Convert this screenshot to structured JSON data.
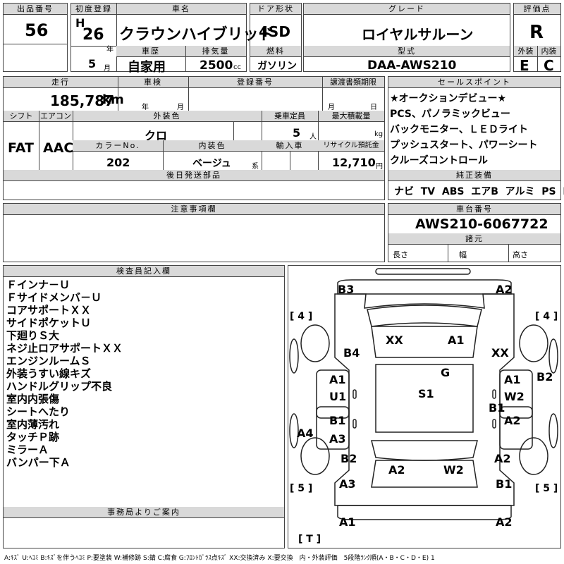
{
  "header": {
    "lot_label": "出品番号",
    "lot_no": "56",
    "reg_label": "初度登録",
    "era": "H",
    "reg_year": "26",
    "year_unit": "年",
    "reg_month": "5",
    "month_unit": "月",
    "name_label": "車名",
    "car_name": "クラウンハイブリッド",
    "history_label": "車歴",
    "history": "自家用",
    "disp_label": "排気量",
    "displacement": "2500",
    "cc": "cc",
    "door_label": "ドア形状",
    "door": "4SD",
    "fuel_label": "燃料",
    "fuel": "ガソリン",
    "grade_label": "グレード",
    "grade": "ロイヤルサルーン",
    "model_label": "型式",
    "model": "DAA-AWS210",
    "score_label": "評価点",
    "score": "R",
    "ext_label": "外装",
    "ext_grade": "E",
    "int_label": "内装",
    "int_grade": "C"
  },
  "row2": {
    "mileage_label": "走行",
    "mileage": "185,787",
    "km": "km",
    "inspection_label": "車検",
    "year_unit": "年",
    "month_unit": "月",
    "regno_label": "登録番号",
    "transfer_label": "譲渡書類期限",
    "transfer_month": "月",
    "transfer_day": "日",
    "shift_label": "シフト",
    "shift": "FAT",
    "ac_label": "エアコン",
    "ac": "AAC",
    "color_label": "外装色",
    "color": "クロ",
    "capacity_label": "乗車定員",
    "capacity": "5",
    "person": "人",
    "maxload_label": "最大積載量",
    "kg": "kg",
    "colorno_label": "カラーNo.",
    "colorno": "202",
    "interior_label": "内装色",
    "interior": "ベージュ",
    "kei": "系",
    "import_label": "輸入車",
    "recycle_label": "リサイクル預託金",
    "recycle": "12,710",
    "yen": "円",
    "later_parts_label": "後日発送部品"
  },
  "selling": {
    "label": "セールスポイント",
    "lines": [
      "★オークションデビュー★",
      "PCS、パノラミックビュー",
      "バックモニター、ＬＥＤライト",
      "プッシュスタート、パワーシート",
      "クルーズコントロール"
    ]
  },
  "equipment": {
    "label": "純正装備",
    "items": [
      "ナビ",
      "TV",
      "ABS",
      "エアB",
      "アルミ",
      "PS",
      "PW"
    ]
  },
  "notes_label": "注意事項欄",
  "chassis": {
    "label": "車台番号",
    "value": "AWS210-6067722",
    "spec_label": "諸元",
    "length": "長さ",
    "width": "幅",
    "height": "高さ"
  },
  "inspector": {
    "label": "検査員記入欄",
    "lines": [
      "Ｆインナ－Ｕ",
      "Ｆサイドメンバ－Ｕ",
      "コアサポートＸＸ",
      "サイドポケットＵ",
      "下廻りＳ大",
      "ネジ止ロアサポートＸＸ",
      "エンジンルームＳ",
      "外装うすい線キズ",
      "ハンドルグリップ不良",
      "室内内張傷",
      "シートへたり",
      "室内薄汚れ",
      "タッチＰ跡",
      "ミラーＡ",
      "バンパー下Ａ"
    ]
  },
  "office_label": "事務局よりご案内",
  "legend": "A:ｷｽﾞ U:ﾍｺﾐ B:ｷｽﾞを伴うﾍｺﾐ P:要塗装 W:補修跡 S:錆 C:腐食 G:ﾌﾛﾝﾄｶﾞﾗｽ点ｷｽﾞ XX:交換済み X:要交換　内・外装評価　5段階ﾗﾝｸ順(A・B・C・D・E) 1",
  "diagram": {
    "tire_lf": "4",
    "tire_rf": "4",
    "tire_lr": "5",
    "tire_rr": "5",
    "spare": "T",
    "codes": {
      "b3": "B3",
      "a2_tr": "A2",
      "xx_hood": "XX",
      "a1_hood": "A1",
      "b4": "B4",
      "xx_r": "XX",
      "g": "G",
      "a1_l": "A1",
      "u1": "U1",
      "s1": "S1",
      "a1_r": "A1",
      "w2": "W2",
      "b2_r": "B2",
      "b1_r": "B1",
      "b1_l": "B1",
      "a3_l": "A3",
      "a2_r2": "A2",
      "a4": "A4",
      "b2_l": "B2",
      "a2_trunk": "A2",
      "w2_trunk": "W2",
      "a2_rr": "A2",
      "a3_b": "A3",
      "b1_rr": "B1",
      "a1_bl": "A1",
      "a2_br": "A2"
    }
  }
}
